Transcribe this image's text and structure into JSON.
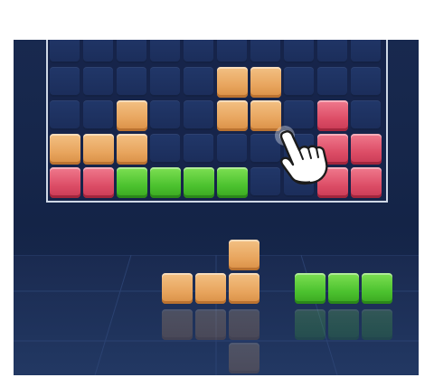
{
  "game": {
    "board": {
      "columns": 10,
      "visible_rows": 5,
      "colors": {
        "orange": "#e8a55e",
        "red": "#dc4d66",
        "green": "#4cc22f",
        "cell": "#1e3262",
        "background": "#16244a",
        "frame": "#cfd8e6"
      },
      "filled_cells": [
        {
          "row": 1,
          "col": 5,
          "color": "orange"
        },
        {
          "row": 1,
          "col": 6,
          "color": "orange"
        },
        {
          "row": 2,
          "col": 2,
          "color": "orange"
        },
        {
          "row": 2,
          "col": 5,
          "color": "orange"
        },
        {
          "row": 2,
          "col": 6,
          "color": "orange"
        },
        {
          "row": 2,
          "col": 8,
          "color": "red"
        },
        {
          "row": 3,
          "col": 0,
          "color": "orange"
        },
        {
          "row": 3,
          "col": 1,
          "color": "orange"
        },
        {
          "row": 3,
          "col": 2,
          "color": "orange"
        },
        {
          "row": 3,
          "col": 8,
          "color": "red"
        },
        {
          "row": 3,
          "col": 9,
          "color": "red"
        },
        {
          "row": 4,
          "col": 0,
          "color": "red"
        },
        {
          "row": 4,
          "col": 1,
          "color": "red"
        },
        {
          "row": 4,
          "col": 2,
          "color": "green"
        },
        {
          "row": 4,
          "col": 3,
          "color": "green"
        },
        {
          "row": 4,
          "col": 4,
          "color": "green"
        },
        {
          "row": 4,
          "col": 5,
          "color": "green"
        },
        {
          "row": 4,
          "col": 8,
          "color": "red"
        },
        {
          "row": 4,
          "col": 9,
          "color": "red"
        }
      ]
    },
    "pieces_tray": [
      {
        "name": "t-piece",
        "color": "orange",
        "cells": [
          [
            0,
            2
          ],
          [
            1,
            0
          ],
          [
            1,
            1
          ],
          [
            1,
            2
          ]
        ]
      },
      {
        "name": "line-piece",
        "color": "green",
        "cells": [
          [
            0,
            0
          ],
          [
            0,
            1
          ],
          [
            0,
            2
          ]
        ]
      }
    ],
    "hint": {
      "icon": "pointing-hand-icon"
    }
  }
}
